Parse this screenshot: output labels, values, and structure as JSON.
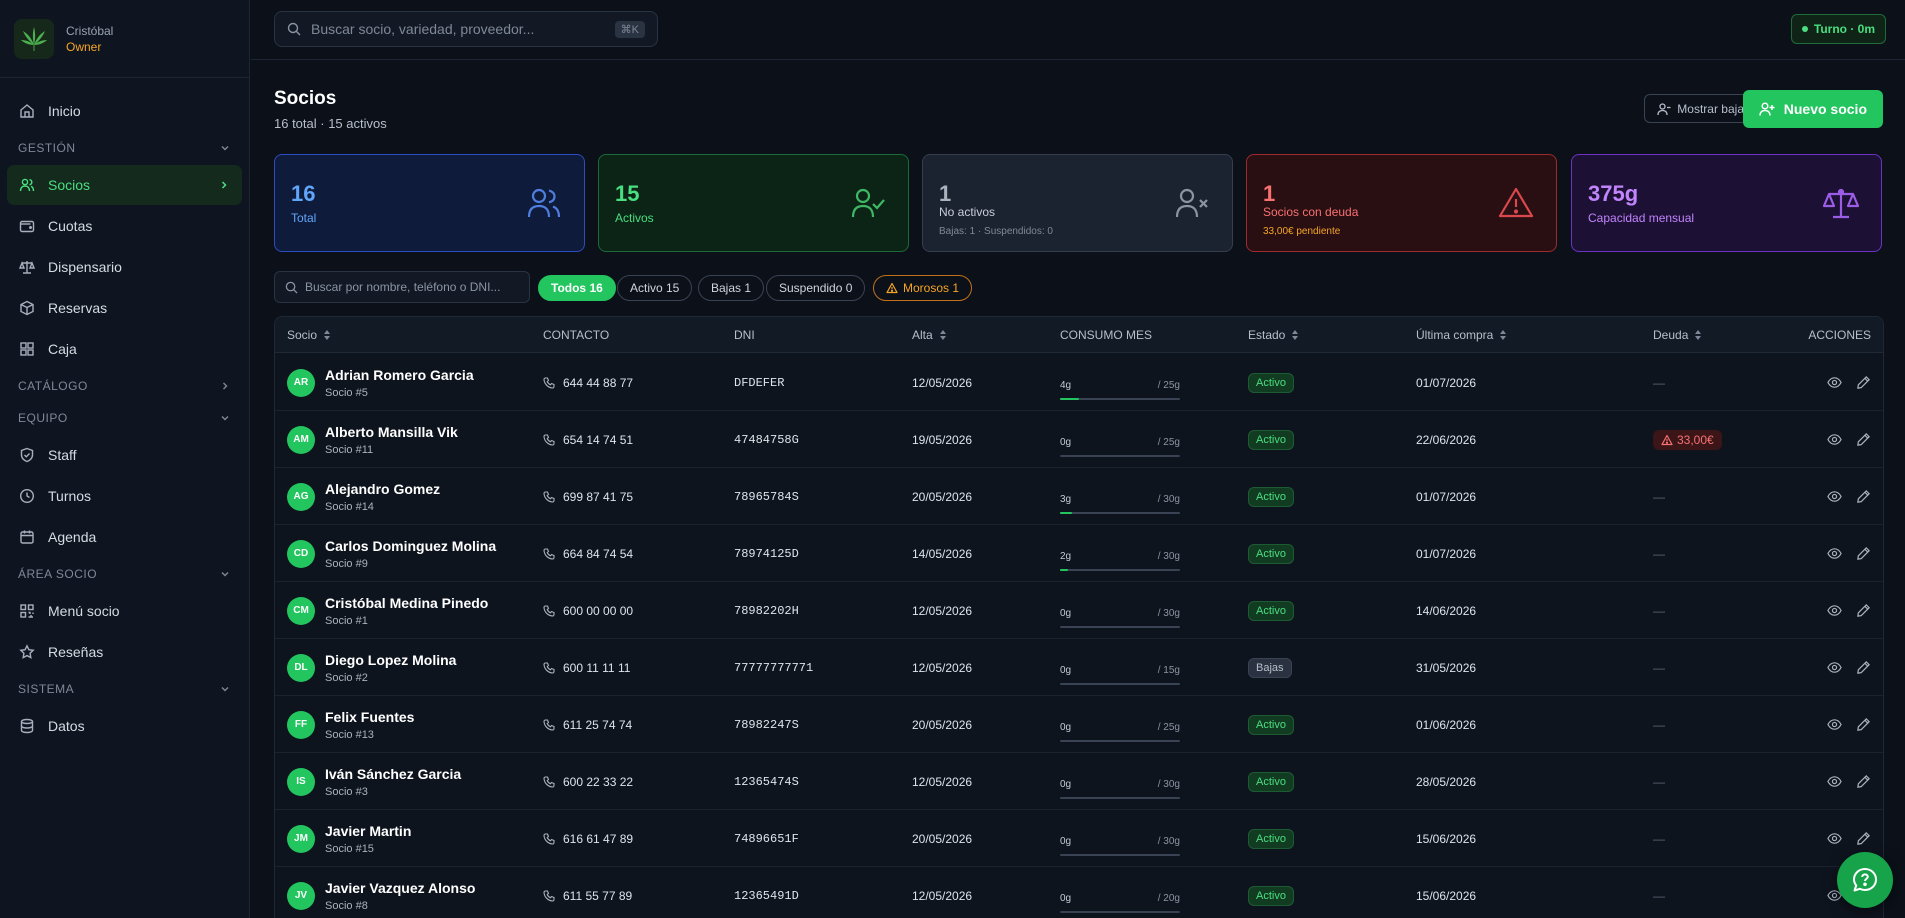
{
  "user": {
    "name": "Cristóbal",
    "role": "Owner"
  },
  "nav": {
    "inicio": "Inicio",
    "gestion": "GESTIÓN",
    "socios": "Socios",
    "cuotas": "Cuotas",
    "dispensario": "Dispensario",
    "reservas": "Reservas",
    "caja": "Caja",
    "catalogo": "CATÁLOGO",
    "equipo": "EQUIPO",
    "staff": "Staff",
    "turnos": "Turnos",
    "agenda": "Agenda",
    "area_socio": "ÁREA SOCIO",
    "menu_socio": "Menú socio",
    "resenas": "Reseñas",
    "sistema": "SISTEMA",
    "datos": "Datos"
  },
  "topbar": {
    "search_placeholder": "Buscar socio, variedad, proveedor...",
    "shortcut": "⌘K",
    "turno": "Turno · 0m"
  },
  "header": {
    "title": "Socios",
    "subtitle": "16 total · 15 activos",
    "show_bajas": "Mostrar bajas",
    "new_socio": "Nuevo socio"
  },
  "stats": {
    "total": {
      "value": "16",
      "label": "Total",
      "color": "#3b82f6"
    },
    "activos": {
      "value": "15",
      "label": "Activos",
      "color": "#22c55e"
    },
    "no_activos": {
      "value": "1",
      "label": "No activos",
      "detail": "Bajas: 1 · Suspendidos: 0"
    },
    "deuda": {
      "value": "1",
      "label": "Socios con deuda",
      "detail": "33,00€ pendiente",
      "color": "#ef4444"
    },
    "capacidad": {
      "value": "375g",
      "label": "Capacidad mensual",
      "color": "#a855f7"
    }
  },
  "filters": {
    "search_placeholder": "Buscar por nombre, teléfono o DNI...",
    "todos": "Todos 16",
    "activo": "Activo 15",
    "bajas": "Bajas 1",
    "suspendido": "Suspendido 0",
    "morosos": "Morosos 1"
  },
  "table": {
    "headers": {
      "socio": "Socio",
      "contacto": "CONTACTO",
      "dni": "DNI",
      "alta": "Alta",
      "consumo": "CONSUMO MES",
      "estado": "Estado",
      "ultima": "Última compra",
      "deuda": "Deuda",
      "acciones": "ACCIONES"
    },
    "rows": [
      {
        "initials": "AR",
        "name": "Adrian Romero Garcia",
        "num": "Socio #5",
        "phone": "644 44 88 77",
        "dni": "DFDEFER",
        "alta": "12/05/2026",
        "used": "4g",
        "cap": "/ 25g",
        "pct": 16,
        "estado": "Activo",
        "ultima": "01/07/2026",
        "deuda": "—"
      },
      {
        "initials": "AM",
        "name": "Alberto Mansilla Vik",
        "num": "Socio #11",
        "phone": "654 14 74 51",
        "dni": "47484758G",
        "alta": "19/05/2026",
        "used": "0g",
        "cap": "/ 25g",
        "pct": 0,
        "estado": "Activo",
        "ultima": "22/06/2026",
        "deuda": "33,00€"
      },
      {
        "initials": "AG",
        "name": "Alejandro Gomez",
        "num": "Socio #14",
        "phone": "699 87 41 75",
        "dni": "78965784S",
        "alta": "20/05/2026",
        "used": "3g",
        "cap": "/ 30g",
        "pct": 10,
        "estado": "Activo",
        "ultima": "01/07/2026",
        "deuda": "—"
      },
      {
        "initials": "CD",
        "name": "Carlos Dominguez Molina",
        "num": "Socio #9",
        "phone": "664 84 74 54",
        "dni": "78974125D",
        "alta": "14/05/2026",
        "used": "2g",
        "cap": "/ 30g",
        "pct": 7,
        "estado": "Activo",
        "ultima": "01/07/2026",
        "deuda": "—"
      },
      {
        "initials": "CM",
        "name": "Cristóbal Medina Pinedo",
        "num": "Socio #1",
        "phone": "600 00 00 00",
        "dni": "78982202H",
        "alta": "12/05/2026",
        "used": "0g",
        "cap": "/ 30g",
        "pct": 0,
        "estado": "Activo",
        "ultima": "14/06/2026",
        "deuda": "—"
      },
      {
        "initials": "DL",
        "name": "Diego Lopez Molina",
        "num": "Socio #2",
        "phone": "600 11 11 11",
        "dni": "77777777771",
        "alta": "12/05/2026",
        "used": "0g",
        "cap": "/ 15g",
        "pct": 0,
        "estado": "Bajas",
        "ultima": "31/05/2026",
        "deuda": "—"
      },
      {
        "initials": "FF",
        "name": "Felix Fuentes",
        "num": "Socio #13",
        "phone": "611 25 74 74",
        "dni": "78982247S",
        "alta": "20/05/2026",
        "used": "0g",
        "cap": "/ 25g",
        "pct": 0,
        "estado": "Activo",
        "ultima": "01/06/2026",
        "deuda": "—"
      },
      {
        "initials": "IS",
        "name": "Iván Sánchez Garcia",
        "num": "Socio #3",
        "phone": "600 22 33 22",
        "dni": "12365474S",
        "alta": "12/05/2026",
        "used": "0g",
        "cap": "/ 30g",
        "pct": 0,
        "estado": "Activo",
        "ultima": "28/05/2026",
        "deuda": "—"
      },
      {
        "initials": "JM",
        "name": "Javier Martin",
        "num": "Socio #15",
        "phone": "616 61 47 89",
        "dni": "74896651F",
        "alta": "20/05/2026",
        "used": "0g",
        "cap": "/ 30g",
        "pct": 0,
        "estado": "Activo",
        "ultima": "15/06/2026",
        "deuda": "—"
      },
      {
        "initials": "JV",
        "name": "Javier Vazquez Alonso",
        "num": "Socio #8",
        "phone": "611 55 77 89",
        "dni": "12365491D",
        "alta": "12/05/2026",
        "used": "0g",
        "cap": "/ 20g",
        "pct": 0,
        "estado": "Activo",
        "ultima": "15/06/2026",
        "deuda": "—"
      }
    ]
  }
}
